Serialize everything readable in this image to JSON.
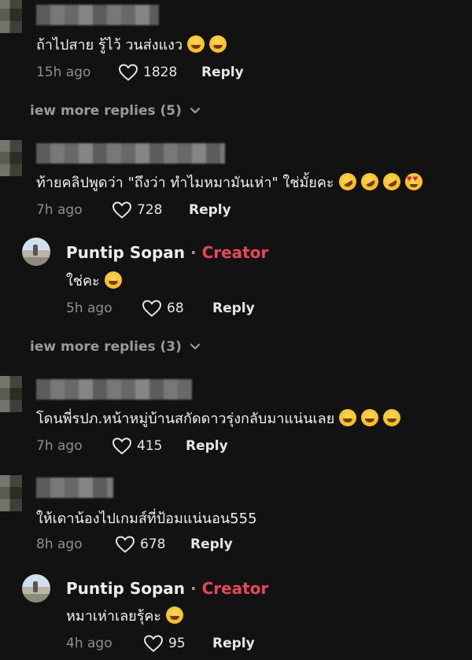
{
  "comments": [
    {
      "text": "ถ้าไปสาย รู้ไว้ วนส่งแงว",
      "time": "15h ago",
      "likes": "1828",
      "reply_label": "Reply",
      "emojis": [
        "laugh",
        "laugh"
      ]
    },
    {
      "text": "ท้ายคลิปพูดว่า \"ถึงว่า ทำไมหมามันเห่า\" ใช่มั้ยคะ",
      "time": "7h ago",
      "likes": "728",
      "reply_label": "Reply",
      "emojis": [
        "rofl",
        "rofl",
        "rofl",
        "love"
      ]
    },
    {
      "text": "โดนพี่รปภ.หน้าหมู่บ้านสกัดดาวรุ่งกลับมาแน่นเลย",
      "time": "7h ago",
      "likes": "415",
      "reply_label": "Reply",
      "emojis": [
        "laugh",
        "laugh",
        "laugh"
      ]
    },
    {
      "text": "ให้เดาน้องไปเกมส์ที่ป้อมแน่นอน555",
      "time": "8h ago",
      "likes": "678",
      "reply_label": "Reply",
      "emojis": []
    }
  ],
  "creator_replies": [
    {
      "name": "Puntip Sopan",
      "separator": "·",
      "tag": "Creator",
      "text": "ใช่คะ",
      "time": "5h ago",
      "likes": "68",
      "reply_label": "Reply"
    },
    {
      "name": "Puntip Sopan",
      "separator": "·",
      "tag": "Creator",
      "text": "หมาเห่าเลยรุ้คะ",
      "time": "4h ago",
      "likes": "95",
      "reply_label": "Reply"
    }
  ],
  "view_more": [
    {
      "label": "iew more replies (5)"
    },
    {
      "label": "iew more replies (3)"
    }
  ],
  "icons": {
    "like": "heart-outline-icon",
    "expand": "chevron-down-icon"
  },
  "colors": {
    "background": "#121212",
    "creator_tag": "#e8475a",
    "meta": "#8f8f8f"
  }
}
